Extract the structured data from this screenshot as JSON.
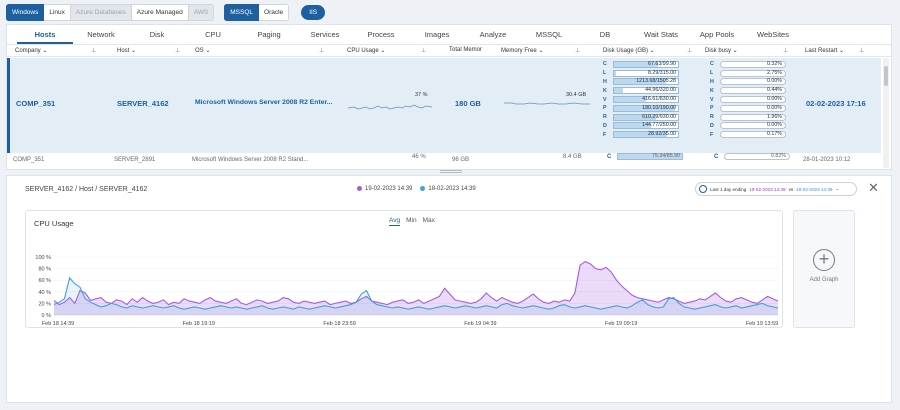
{
  "top_bar": {
    "os_filters": [
      {
        "label": "Windows",
        "state": "active"
      },
      {
        "label": "Linux",
        "state": "normal"
      },
      {
        "label": "Azure Databases",
        "state": "dim"
      },
      {
        "label": "Azure Managed",
        "state": "normal"
      },
      {
        "label": "AWS",
        "state": "dim"
      }
    ],
    "db_filters": [
      {
        "label": "MSSQL",
        "state": "active"
      },
      {
        "label": "Oracle",
        "state": "normal"
      }
    ],
    "iis_label": "IIS"
  },
  "tabs": [
    "Hosts",
    "Network",
    "Disk",
    "CPU",
    "Paging",
    "Services",
    "Process",
    "Images",
    "Analyze",
    "MSSQL",
    "DB",
    "Wait Stats",
    "App Pools",
    "WebSites"
  ],
  "active_tab": "Hosts",
  "columns": [
    "Company ⌄",
    "Host ⌄",
    "OS ⌄",
    "CPU Usage ⌄",
    "Total Memor",
    "Memory Free ⌄",
    "Disk Usage (GB) ⌄",
    "Disk busy ⌄",
    "Last Restart ⌄"
  ],
  "selected_row": {
    "company": "COMP_351",
    "host": "SERVER_4162",
    "os": "Microsoft Windows Server 2008 R2 Enter...",
    "cpu_usage": "37 %",
    "total_memory": "180 GB",
    "memory_free": "30.4 GB",
    "last_restart": "02-02-2023 17:16",
    "disk_usage": [
      {
        "letter": "C",
        "value": "67.63/99.90",
        "ratio": 0.68
      },
      {
        "letter": "L",
        "value": "8.29/315.00",
        "ratio": 0.03
      },
      {
        "letter": "H",
        "value": "1213.68/1505.28",
        "ratio": 0.81
      },
      {
        "letter": "K",
        "value": "44.96/320.00",
        "ratio": 0.14
      },
      {
        "letter": "V",
        "value": "416.61/830.00",
        "ratio": 0.5
      },
      {
        "letter": "P",
        "value": "180.10/190.00",
        "ratio": 0.95
      },
      {
        "letter": "R",
        "value": "610.29/930.00",
        "ratio": 0.66
      },
      {
        "letter": "D",
        "value": "144.77/250.00",
        "ratio": 0.58
      },
      {
        "letter": "F",
        "value": "28.92/35.00",
        "ratio": 0.83
      }
    ],
    "disk_busy": [
      {
        "letter": "C",
        "value": "0.32%"
      },
      {
        "letter": "L",
        "value": "2.75%"
      },
      {
        "letter": "H",
        "value": "0.00%"
      },
      {
        "letter": "K",
        "value": "0.44%"
      },
      {
        "letter": "V",
        "value": "0.00%"
      },
      {
        "letter": "P",
        "value": "0.00%"
      },
      {
        "letter": "R",
        "value": "1.96%"
      },
      {
        "letter": "D",
        "value": "0.00%"
      },
      {
        "letter": "F",
        "value": "0.17%"
      }
    ]
  },
  "next_row": {
    "company": "COMP_351",
    "host": "SERVER_2891",
    "os": "Microsoft Windows Server 2008 R2 Stand...",
    "cpu_usage": "46 %",
    "total_memory": "96 GB",
    "memory_free": "8.4 GB",
    "disk_c": "75.34/85.90",
    "disk_busy_c": "0.82%",
    "last_restart": "28-01-2023 10:12"
  },
  "detail": {
    "breadcrumb": "SERVER_4162 / Host / SERVER_4162",
    "legend_purple": "19-02-2023 14:39",
    "legend_blue": "18-02-2023 14:39",
    "range_prefix": "Last 1 day ending",
    "range_purple": "19-02-2023 14:39",
    "range_vs": "vs",
    "range_blue": "18-02-2023 14:39",
    "add_graph": "Add Graph",
    "colors": {
      "purple": "#a45de0",
      "blue": "#3fa0dc"
    }
  },
  "chart_data": {
    "type": "area",
    "title": "CPU Usage",
    "aggregations": [
      "Avg",
      "Min",
      "Max"
    ],
    "active_aggregation": "Avg",
    "ylabel": "%",
    "y_ticks": [
      "100 %",
      "80 %",
      "60 %",
      "40 %",
      "20 %",
      "0 %"
    ],
    "ylim": [
      0,
      100
    ],
    "x_ticks": [
      "Feb 18 14:39",
      "Feb 18 19:19",
      "Feb 18 23:59",
      "Feb 19 04:39",
      "Feb 19 09:19",
      "Feb 19 13:59"
    ],
    "series": [
      {
        "name": "19-02-2023 14:39",
        "color": "#a45de0",
        "values": [
          25,
          18,
          22,
          30,
          20,
          42,
          38,
          25,
          28,
          30,
          22,
          20,
          26,
          24,
          18,
          28,
          22,
          30,
          24,
          20,
          22,
          26,
          18,
          22,
          20,
          28,
          24,
          22,
          20,
          26,
          30,
          24,
          22,
          20,
          24,
          28,
          20,
          18,
          22,
          26,
          24,
          20,
          22,
          24,
          30,
          28,
          22,
          20,
          24,
          22,
          20,
          22,
          24,
          18,
          20,
          22,
          24,
          20,
          22,
          28,
          32,
          24,
          22,
          20,
          18,
          22,
          24,
          26,
          20,
          22,
          26,
          20,
          24,
          28,
          32,
          46,
          36,
          26,
          24,
          22,
          20,
          22,
          28,
          38,
          30,
          24,
          30,
          26,
          22,
          20,
          24,
          30,
          36,
          28,
          22,
          20,
          24,
          22,
          26,
          24,
          38,
          86,
          92,
          88,
          80,
          78,
          82,
          74,
          60,
          50,
          42,
          34,
          30,
          28,
          26,
          24,
          22,
          26,
          30,
          28,
          24,
          20,
          22,
          24,
          28,
          26,
          32,
          38,
          30,
          24,
          22,
          28,
          30,
          26,
          22,
          20,
          26,
          32,
          28,
          24
        ]
      },
      {
        "name": "18-02-2023 14:39",
        "color": "#3fa0dc",
        "values": [
          18,
          22,
          28,
          64,
          54,
          48,
          28,
          22,
          18,
          14,
          16,
          20,
          18,
          14,
          12,
          16,
          14,
          12,
          14,
          16,
          14,
          12,
          14,
          16,
          12,
          10,
          12,
          14,
          12,
          10,
          12,
          14,
          16,
          14,
          12,
          14,
          12,
          10,
          12,
          14,
          16,
          12,
          10,
          12,
          14,
          12,
          10,
          14,
          12,
          10,
          12,
          14,
          16,
          14,
          12,
          14,
          16,
          18,
          22,
          36,
          42,
          24,
          18,
          16,
          14,
          12,
          14,
          12,
          10,
          12,
          14,
          12,
          10,
          12,
          14,
          16,
          14,
          12,
          14,
          16,
          14,
          12,
          14,
          16,
          14,
          12,
          18,
          20,
          16,
          14,
          12,
          14,
          16,
          14,
          12,
          10,
          12,
          16,
          18,
          14,
          12,
          14,
          16,
          14,
          12,
          10,
          12,
          14,
          16,
          14,
          12,
          16,
          22,
          26,
          18,
          14,
          12,
          14,
          28,
          30,
          20,
          14,
          12,
          10,
          12,
          14,
          16,
          18,
          14,
          12,
          14,
          16,
          12,
          14,
          16,
          18,
          20,
          16,
          14,
          12
        ]
      }
    ]
  }
}
